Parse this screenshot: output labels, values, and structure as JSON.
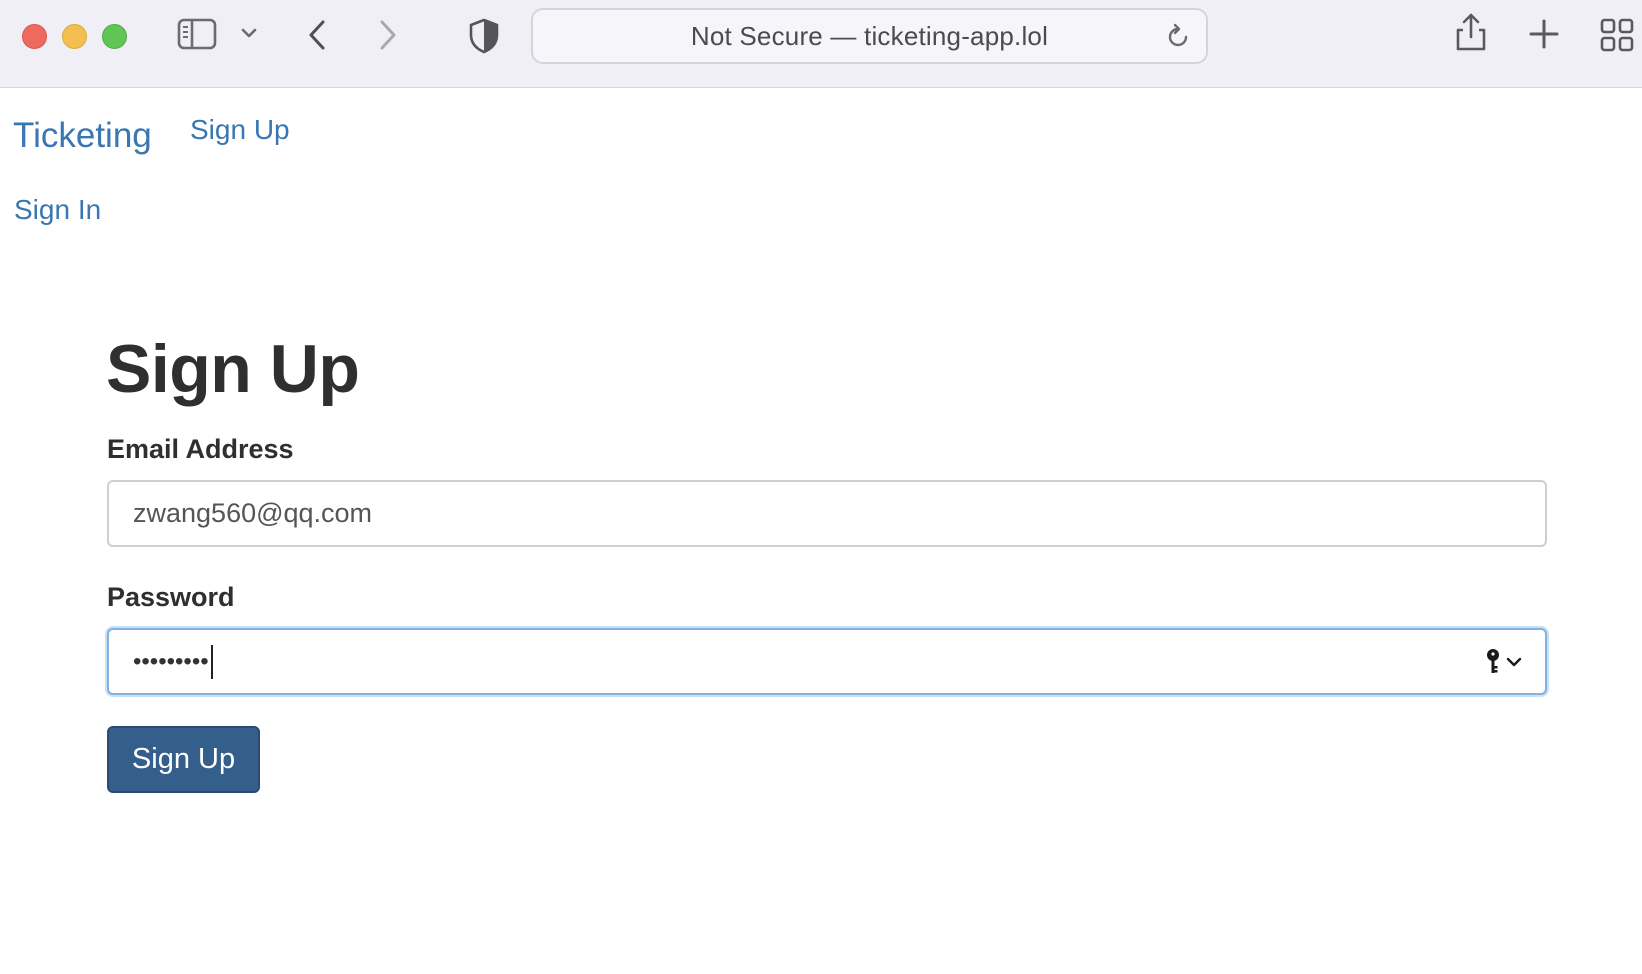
{
  "browser": {
    "address_text": "Not Secure — ticketing-app.lol",
    "icons": [
      "sidebar-icon",
      "chevron-down-icon",
      "back-icon",
      "forward-icon",
      "shield-icon",
      "reload-icon",
      "share-icon",
      "plus-icon",
      "tab-overview-icon"
    ]
  },
  "nav": {
    "brand": "Ticketing",
    "signup_link": "Sign Up",
    "signin_link": "Sign In"
  },
  "form": {
    "title": "Sign Up",
    "email_label": "Email Address",
    "email_value": "zwang560@qq.com",
    "password_label": "Password",
    "password_masked": "•••••••••",
    "submit_label": "Sign Up"
  },
  "colors": {
    "link": "#3a76b2",
    "button": "#345f8c",
    "focus_ring": "#82b1e2",
    "toolbar_bg": "#f1eff6"
  }
}
